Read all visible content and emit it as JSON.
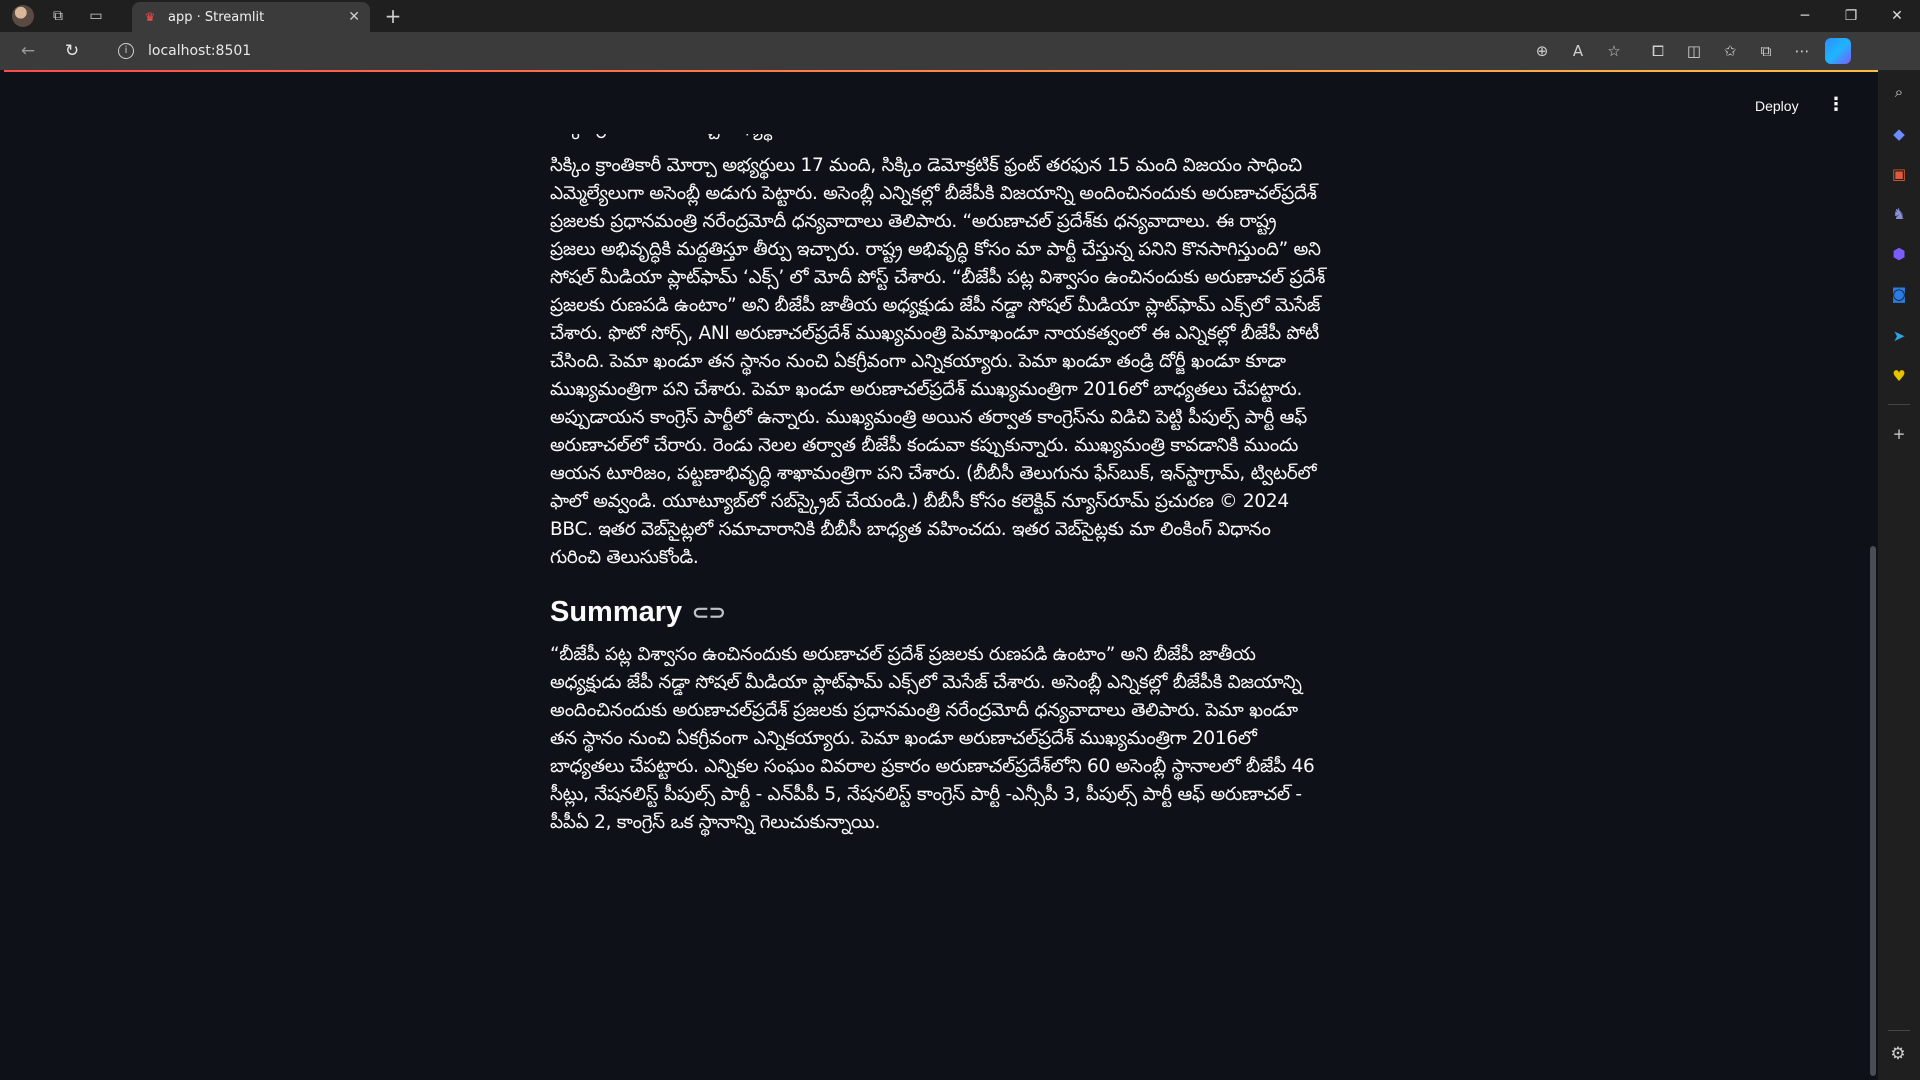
{
  "browser": {
    "tab_title": "app · Streamlit",
    "tab_close": "✕",
    "new_tab": "+",
    "url": "localhost:8501",
    "window_controls": {
      "minimize": "─",
      "restore": "❐",
      "close": "✕"
    },
    "icons": [
      "workspaces-icon",
      "vertical-tabs-icon",
      "back-icon",
      "refresh-icon",
      "zoom-icon",
      "read-aloud-icon",
      "favorite-star-icon",
      "extensions-icon",
      "split-screen-icon",
      "favorites-icon",
      "collections-icon",
      "more-icon",
      "copilot-icon"
    ]
  },
  "edge_sidebar": {
    "icons": [
      "search-icon",
      "tag-icon",
      "toolbox-icon",
      "games-icon",
      "office-icon",
      "outlook-icon",
      "telegram-icon",
      "ext-icon",
      "add-icon",
      "settings-icon"
    ]
  },
  "app": {
    "deploy_label": "Deploy",
    "menu_icon": "⋮",
    "article_cut_line": "సిక్కిం క్రాంతికారీ మోర్చా అభ్యర్థులు 17 మంది",
    "article_text": "సిక్కిం క్రాంతికారీ మోర్చా అభ్యర్థులు 17 మంది, సిక్కిం డెమోక్రటిక్ ఫ్రంట్ తరఫున 15 మంది విజయం సాధించి ఎమ్మెల్యేలుగా అసెంబ్లీ అడుగు పెట్టారు. అసెంబ్లీ ఎన్నికల్లో బీజేపీకి విజయాన్ని అందించినందుకు అరుణాచల్‌ప్రదేశ్ ప్రజలకు ప్రధానమంత్రి నరేంద్రమోదీ ధన్యవాదాలు తెలిపారు. “అరుణాచల్ ప్రదేశ్‌కు ధన్యవాదాలు. ఈ రాష్ట్ర ప్రజలు అభివృద్ధికి మద్దతిస్తూ తీర్పు ఇచ్చారు. రాష్ట్ర అభివృద్ధి కోసం మా పార్టీ చేస్తున్న పనిని కొనసాగిస్తుంది” అని సోషల్ మీడియా ప్లాట్‌ఫామ్ ‘ఎక్స్’ లో మోదీ పోస్ట్ చేశారు. “బీజేపీ పట్ల విశ్వాసం ఉంచినందుకు అరుణాచల్ ప్రదేశ్ ప్రజలకు రుణపడి ఉంటాం” అని బీజేపీ జాతీయ అధ్యక్షుడు జేపీ నడ్డా సోషల్ మీడియా ప్లాట్‌ఫామ్ ఎక్స్‌లో మెసేజ్ చేశారు. ఫొటో సోర్స్, ANI అరుణాచల్‌ప్రదేశ్ ముఖ్యమంత్రి పెమాఖండూ నాయకత్వంలో ఈ ఎన్నికల్లో బీజేపీ పోటీ చేసింది. పెమా ఖండూ తన స్థానం నుంచి ఏకగ్రీవంగా ఎన్నికయ్యారు. పెమా ఖండూ తండ్రి దోర్జీ ఖండూ కూడా ముఖ్యమంత్రిగా పని చేశారు. పెమా ఖండూ అరుణాచల్‌ప్రదేశ్ ముఖ్యమంత్రిగా 2016లో బాధ్యతలు చేపట్టారు. అప్పుడాయన కాంగ్రెస్ పార్టీలో ఉన్నారు. ముఖ్యమంత్రి అయిన తర్వాత కాంగ్రెస్‌ను విడిచి పెట్టి పీపుల్స్ పార్టీ ఆఫ్ అరుణాచల్‌లో చేరారు. రెండు నెలల తర్వాత బీజేపీ కండువా కప్పుకున్నారు. ముఖ్యమంత్రి కావడానికి ముందు ఆయన టూరిజం, పట్టణాభివృద్ధి శాఖామంత్రిగా పని చేశారు. (బీబీసీ తెలుగును ఫేస్‌బుక్, ఇన్‌స్టాగ్రామ్, ట్విటర్‌లో ఫాలో అవ్వండి. యూట్యూబ్‌లో సబ్‌స్క్రైబ్ చేయండి.) బీబీసీ కోసం కలెక్టివ్ న్యూస్‌రూమ్ ప్రచురణ © 2024 BBC. ఇతర వెబ్‌సైట్లలో సమాచారానికి బీబీసీ బాధ్యత వహించదు. ఇతర వెబ్‌సైట్లకు మా లింకింగ్ విధానం గురించి తెలుసుకోండి.",
    "summary_heading": "Summary",
    "summary_text": "“బీజేపీ పట్ల విశ్వాసం ఉంచినందుకు అరుణాచల్ ప్రదేశ్ ప్రజలకు రుణపడి ఉంటాం” అని బీజేపీ జాతీయ అధ్యక్షుడు జేపీ నడ్డా సోషల్ మీడియా ప్లాట్‌ఫామ్ ఎక్స్‌లో మెసేజ్ చేశారు. అసెంబ్లీ ఎన్నికల్లో బీజేపీకి విజయాన్ని అందించినందుకు అరుణాచల్‌ప్రదేశ్ ప్రజలకు ప్రధానమంత్రి నరేంద్రమోదీ ధన్యవాదాలు తెలిపారు. పెమా ఖండూ తన స్థానం నుంచి ఏకగ్రీవంగా ఎన్నికయ్యారు. పెమా ఖండూ అరుణాచల్‌ప్రదేశ్ ముఖ్యమంత్రిగా 2016లో బాధ్యతలు చేపట్టారు. ఎన్నికల సంఘం వివరాల ప్రకారం అరుణాచల్‌ప్రదేశ్‌లోని 60 అసెంబ్లీ స్థానాలలో బీజేపీ 46 సీట్లు, నేషనలిస్ట్ పీపుల్స్ పార్టీ - ఎన్‌పీపీ 5, నేషనలిస్ట్ కాంగ్రెస్ పార్టీ -ఎన్సీపీ 3, పీపుల్స్ పార్టీ ఆఫ్ అరుణాచల్ - పీపీఏ 2, కాంగ్రెస్ ఒక స్థానాన్ని గెలుచుకున్నాయి."
  },
  "colors": {
    "app_bg": "#0e1117",
    "text": "#fafafa",
    "accent": "#ff4b4b"
  }
}
